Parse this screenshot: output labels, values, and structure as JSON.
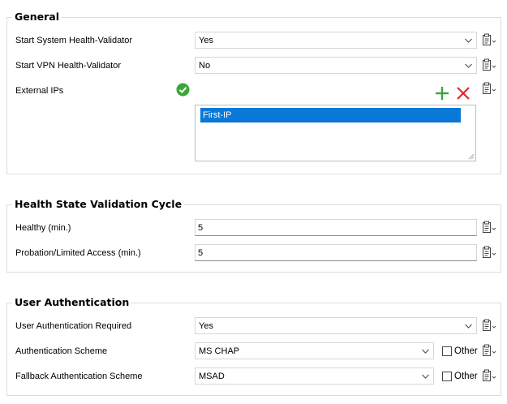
{
  "general": {
    "title": "General",
    "start_system_hv": {
      "label": "Start System Health-Validator",
      "value": "Yes"
    },
    "start_vpn_hv": {
      "label": "Start VPN Health-Validator",
      "value": "No"
    },
    "external_ips": {
      "label": "External IPs",
      "items": [
        "First-IP"
      ]
    }
  },
  "health_cycle": {
    "title": "Health State Validation Cycle",
    "healthy": {
      "label": "Healthy (min.)",
      "value": "5"
    },
    "probation": {
      "label": "Probation/Limited Access (min.)",
      "value": "5"
    }
  },
  "user_auth": {
    "title": "User Authentication",
    "required": {
      "label": "User Authentication Required",
      "value": "Yes"
    },
    "scheme": {
      "label": "Authentication Scheme",
      "value": "MS CHAP",
      "other_label": "Other"
    },
    "fallback": {
      "label": "Fallback Authentication Scheme",
      "value": "MSAD",
      "other_label": "Other"
    }
  },
  "colors": {
    "selection": "#0a78d7",
    "success": "#3aa63a",
    "add": "#3aa63a",
    "remove": "#e0262d",
    "border": "#dcdcdc"
  },
  "icons": {
    "dropdown": "chevron-down-icon",
    "clipboard": "clipboard-menu-icon",
    "valid": "check-circle-icon",
    "add": "plus-icon",
    "remove": "x-icon"
  }
}
